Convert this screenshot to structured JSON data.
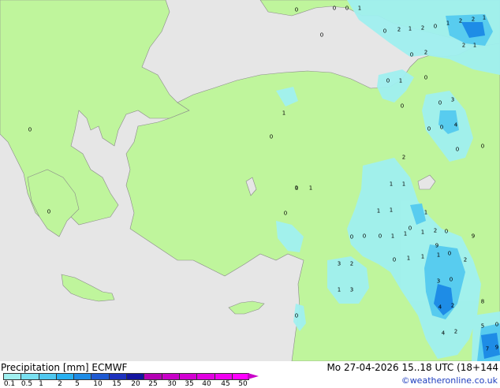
{
  "map": {
    "rain_labels": [
      "0",
      "0",
      "0",
      "1",
      "0",
      "0",
      "2",
      "1",
      "2",
      "0",
      "1",
      "2",
      "2",
      "1",
      "2",
      "0",
      "1",
      "2",
      "0",
      "1",
      "0",
      "0",
      "0",
      "3",
      "0",
      "1",
      "0",
      "0",
      "0",
      "4",
      "0",
      "0",
      "2",
      "1",
      "1",
      "0",
      "1",
      "1",
      "1",
      "0",
      "0",
      "0",
      "0",
      "0",
      "1",
      "1",
      "1",
      "2",
      "0",
      "1",
      "1",
      "1",
      "0",
      "3",
      "2",
      "3",
      "0",
      "1",
      "3",
      "4",
      "2",
      "8",
      "0",
      "4",
      "2",
      "5",
      "0",
      "7",
      "9",
      "1",
      "9",
      "0",
      "0",
      "1",
      "9",
      "2"
    ]
  },
  "footer": {
    "title": "Precipitation [mm]  ECMWF",
    "run_info": "Mo 27-04-2026 15..18 UTC (18+144",
    "credit": "©weatheronline.co.uk",
    "legend_ticks": [
      "0.1",
      "0.5",
      "1",
      "2",
      "5",
      "10",
      "15",
      "20",
      "25",
      "30",
      "35",
      "40",
      "45",
      "50"
    ],
    "legend_colors": [
      "#a0f0f0",
      "#78e0f0",
      "#50c8f0",
      "#28b0f0",
      "#1e8ce6",
      "#1e5ad2",
      "#1e32be",
      "#1414a0",
      "#b400b4",
      "#c800c8",
      "#d200d2",
      "#e100e1",
      "#f000f0",
      "#ff00ff"
    ]
  }
}
